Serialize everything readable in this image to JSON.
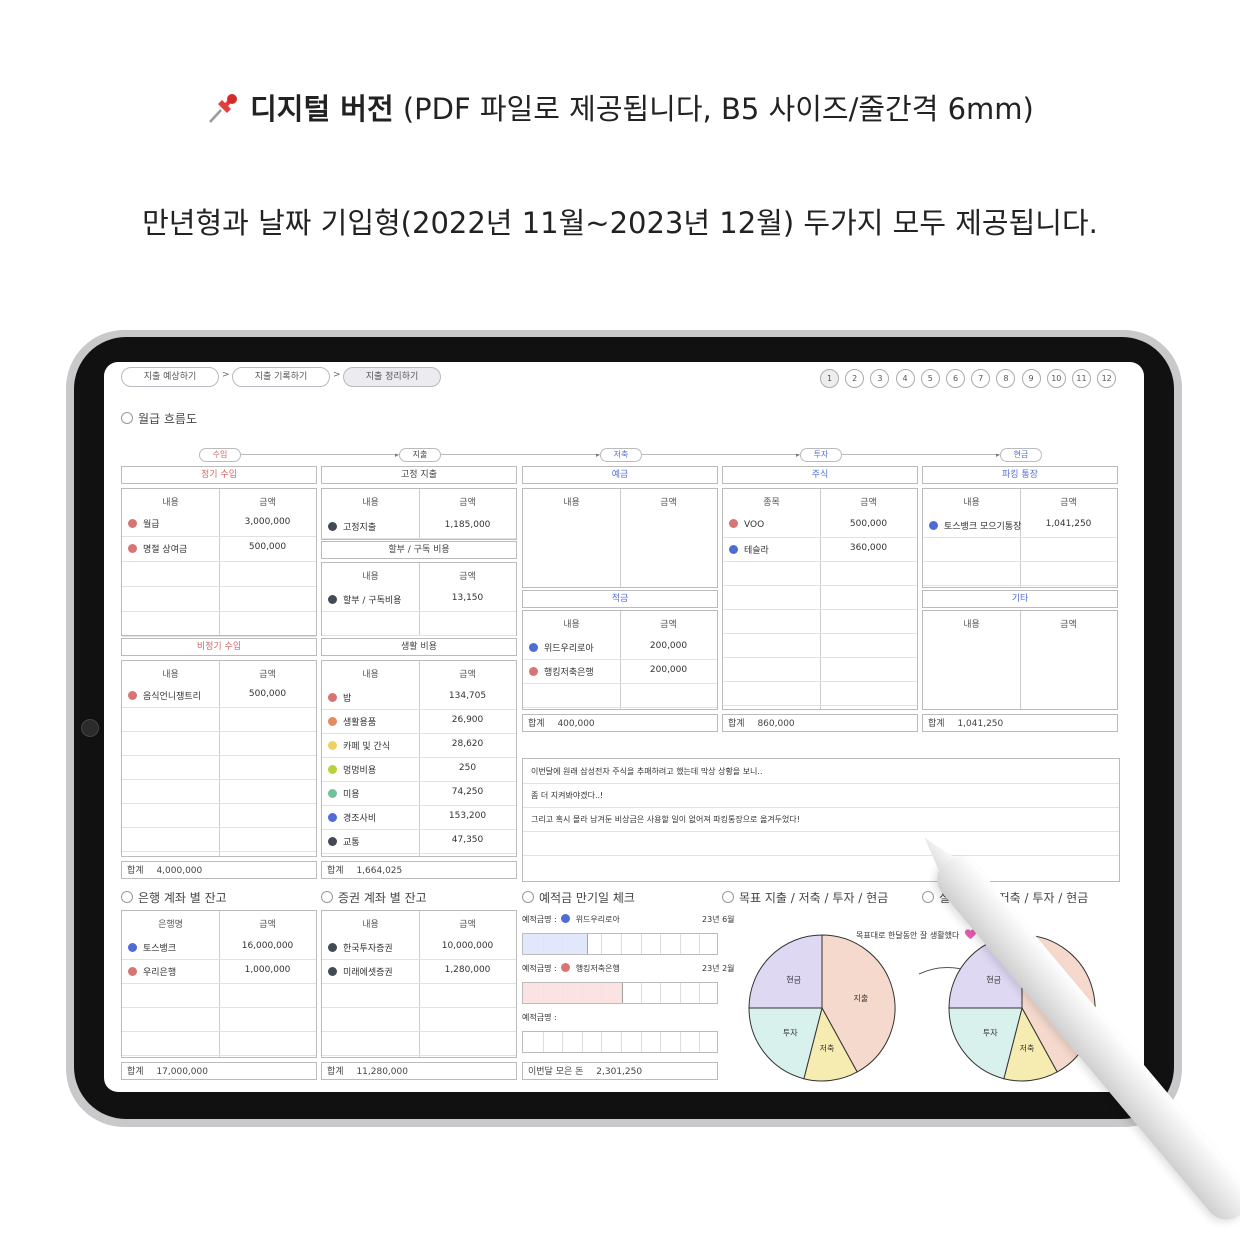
{
  "header": {
    "title_bold": "디지털 버전",
    "title_rest": " (PDF 파일로 제공됩니다, B5 사이즈/줄간격 6mm)",
    "subtitle": "만년형과 날짜 기입형(2022년 11월~2023년 12월) 두가지 모두 제공됩니다."
  },
  "nav": {
    "crumbs": [
      "지출 예상하기",
      "지출 기록하기",
      "지출 정리하기"
    ],
    "sep": ">",
    "pages": [
      "1",
      "2",
      "3",
      "4",
      "5",
      "6",
      "7",
      "8",
      "9",
      "10",
      "11",
      "12"
    ]
  },
  "flow": {
    "section_title": "월급 흐름도",
    "stages": [
      "수입",
      "지출",
      "저축",
      "투자",
      "현금"
    ]
  },
  "columns": {
    "content": "내용",
    "amount": "금액",
    "stock": "종목",
    "bank": "은행명"
  },
  "income": {
    "regular_title": "정기 수입",
    "regular": [
      {
        "name": "월급",
        "amount": "3,000,000",
        "color": "#d97474"
      },
      {
        "name": "명절 상여금",
        "amount": "500,000",
        "color": "#d97474"
      }
    ],
    "irregular_title": "비정기 수입",
    "irregular": [
      {
        "name": "음식언니쟁트리",
        "amount": "500,000",
        "color": "#d97474"
      }
    ],
    "total_label": "합계",
    "total": "4,000,000"
  },
  "expense": {
    "fixed_title": "고정 지출",
    "fixed": [
      {
        "name": "고정지출",
        "amount": "1,185,000",
        "color": "#444a55"
      }
    ],
    "installment_title": "할부 / 구독 비용",
    "installment": [
      {
        "name": "할부 / 구독비용",
        "amount": "13,150",
        "color": "#444a55"
      }
    ],
    "living_title": "생활 비용",
    "living": [
      {
        "name": "밥",
        "amount": "134,705",
        "color": "#d97474"
      },
      {
        "name": "생활용품",
        "amount": "26,900",
        "color": "#e58a5e"
      },
      {
        "name": "카페 및 간식",
        "amount": "28,620",
        "color": "#efd060"
      },
      {
        "name": "멍멍비용",
        "amount": "250",
        "color": "#b9d23c"
      },
      {
        "name": "미용",
        "amount": "74,250",
        "color": "#6fc39a"
      },
      {
        "name": "경조사비",
        "amount": "153,200",
        "color": "#4f6bd4"
      },
      {
        "name": "교통",
        "amount": "47,350",
        "color": "#444a55"
      }
    ],
    "total_label": "합계",
    "total": "1,664,025"
  },
  "savings": {
    "deposit_title": "예금",
    "installment_title": "적금",
    "installment": [
      {
        "name": "위드우리로아",
        "amount": "200,000",
        "color": "#4f6bd4"
      },
      {
        "name": "행킹저축은행",
        "amount": "200,000",
        "color": "#d97474"
      }
    ],
    "total_label": "합계",
    "total": "400,000"
  },
  "invest": {
    "stock_title": "주식",
    "stocks": [
      {
        "name": "VOO",
        "amount": "500,000",
        "color": "#d97474"
      },
      {
        "name": "테슬라",
        "amount": "360,000",
        "color": "#4f6bd4"
      }
    ],
    "total_label": "합계",
    "total": "860,000"
  },
  "cash": {
    "parking_title": "파킹 통장",
    "parking": [
      {
        "name": "토스뱅크 모으기통장",
        "amount": "1,041,250",
        "color": "#4f6bd4"
      }
    ],
    "etc_title": "기타",
    "total_label": "합계",
    "total": "1,041,250"
  },
  "memo": [
    "이번달에 원래 삼성전자 주식을 추매하려고 했는데 막상 상황을 보니..",
    "좀 더 지켜봐야겠다..!",
    "그리고 혹시 몰라 남겨둔 비상금은 사용할 일이 없어져 파킹통장으로 옮겨두었다!"
  ],
  "bank_balance": {
    "title": "은행 계좌 별 잔고",
    "rows": [
      {
        "name": "토스뱅크",
        "amount": "16,000,000",
        "color": "#4f6bd4"
      },
      {
        "name": "우리은행",
        "amount": "1,000,000",
        "color": "#d97474"
      }
    ],
    "total_label": "합계",
    "total": "17,000,000"
  },
  "securities_balance": {
    "title": "증권 계좌 별 잔고",
    "rows": [
      {
        "name": "한국투자증권",
        "amount": "10,000,000",
        "color": "#444a55"
      },
      {
        "name": "미래에셋증권",
        "amount": "1,280,000",
        "color": "#444a55"
      }
    ],
    "total_label": "합계",
    "total": "11,280,000"
  },
  "maturity": {
    "title": "예적금 만기일 체크",
    "label": "예적금명 :",
    "items": [
      {
        "name": "위드우리로아",
        "date": "23년 6월",
        "progress": 0.33,
        "color": "#4f6bd4",
        "fill": "#dfe6fb"
      },
      {
        "name": "행킹저축은행",
        "date": "23년 2월",
        "progress": 0.51,
        "color": "#d97474",
        "fill": "#fbe1e1"
      },
      {
        "name": "",
        "date": "",
        "progress": 0,
        "color": "",
        "fill": ""
      }
    ],
    "month_label": "이번달 모은 돈",
    "month_total": "2,301,250"
  },
  "goal": {
    "title": "목표 지출 / 저축 / 투자 / 현금",
    "actual_title": "실천 지출 / 저축 / 투자 / 현금",
    "note": "목표대로 한달동안 잘 생활했다",
    "heart_color": "#e65fb0",
    "chart_data": {
      "type": "pie",
      "categories": [
        "지출",
        "저축",
        "투자",
        "현금"
      ],
      "values": [
        42,
        12,
        21,
        25
      ],
      "colors": [
        "#f6d9cd",
        "#f6ebb0",
        "#d8f1ec",
        "#ded8f3"
      ]
    }
  }
}
